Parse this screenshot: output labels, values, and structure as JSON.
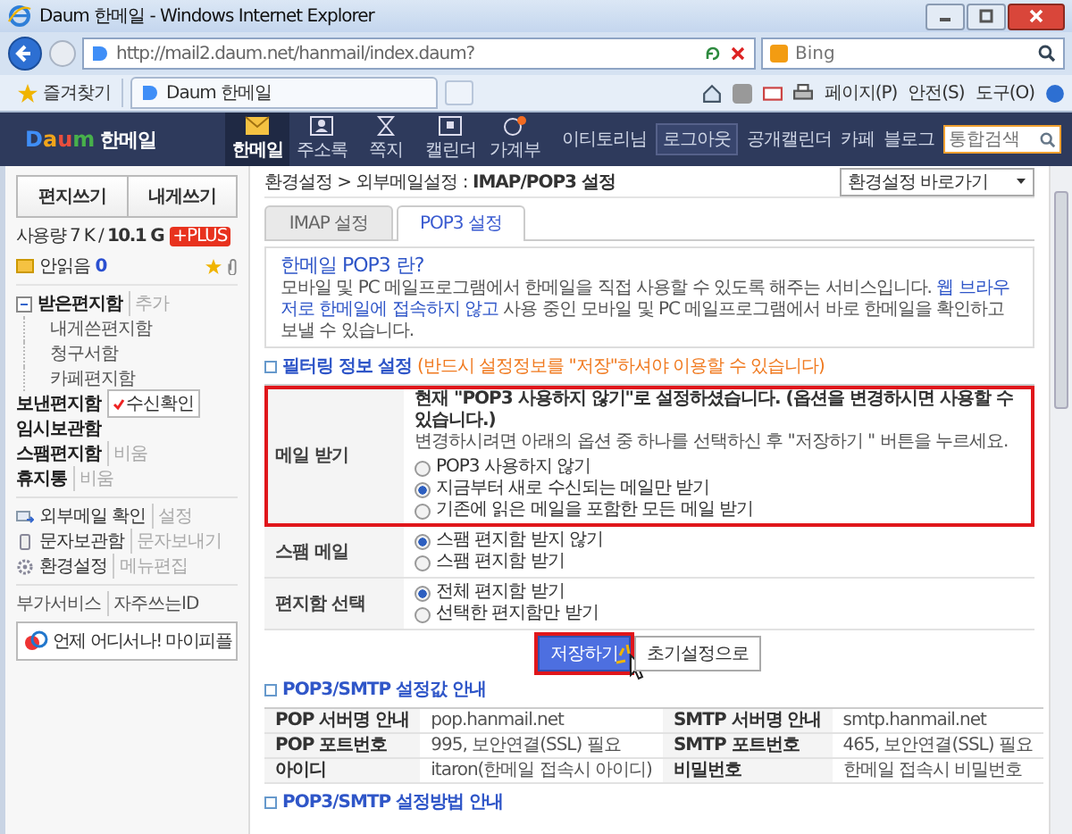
{
  "window": {
    "title": "Daum 한메일 - Windows Internet Explorer"
  },
  "address_bar": {
    "url": "http://mail2.daum.net/hanmail/index.daum?"
  },
  "search_box": {
    "placeholder": "Bing"
  },
  "favorites_bar": {
    "favorites": "즐겨찾기",
    "tab": "Daum 한메일",
    "commands": [
      "페이지(P)",
      "안전(S)",
      "도구(O)"
    ]
  },
  "site_header": {
    "logo": "Daum",
    "service": "한메일",
    "nav": [
      {
        "label": "한메일",
        "kind": "mail",
        "selected": true
      },
      {
        "label": "주소록",
        "kind": "contacts",
        "selected": false
      },
      {
        "label": "쪽지",
        "kind": "note",
        "selected": false
      },
      {
        "label": "캘린더",
        "kind": "calendar",
        "selected": false
      },
      {
        "label": "가계부",
        "kind": "budget",
        "selected": false
      }
    ],
    "user": "이티토리님",
    "logout": "로그아웃",
    "links": [
      "공개캘린더",
      "카페",
      "블로그"
    ],
    "search": {
      "placeholder": "통합검색"
    }
  },
  "sidebar": {
    "buttons": [
      "편지쓰기",
      "내게쓰기"
    ],
    "usage": {
      "text": "사용량 7 K / **10.1 G**",
      "badge": "+PLUS"
    },
    "unread": {
      "label": "안읽음",
      "count": "0"
    },
    "folders": [
      {
        "name": "받은편지함",
        "expanded": true,
        "action": "추가",
        "children": [
          {
            "name": "내게쓴편지함"
          },
          {
            "name": "청구서함"
          },
          {
            "name": "카페편지함"
          }
        ]
      },
      {
        "name": "보낸편지함",
        "tag": "수신확인"
      },
      {
        "name": "임시보관함"
      },
      {
        "name": "스팸편지함",
        "action": "비움"
      },
      {
        "name": "휴지통",
        "action": "비움"
      }
    ],
    "tools": [
      {
        "name": "외부메일 확인",
        "kind": "external",
        "action": "설정"
      },
      {
        "name": "문자보관함",
        "kind": "sms",
        "action": "문자보내기"
      },
      {
        "name": "환경설정",
        "kind": "settings",
        "action": "메뉴편집"
      }
    ],
    "extras": [
      "부가서비스",
      "자주쓰는ID"
    ],
    "promo_button": "언제 어디서나! 마이피플"
  },
  "main": {
    "breadcrumb": "환경설정 > 외부메일설정 : **IMAP/POP3 설정**",
    "shortcut_select": {
      "value": "환경설정 바로가기"
    },
    "tabs": [
      {
        "label": "IMAP 설정",
        "selected": false
      },
      {
        "label": "POP3 설정",
        "selected": true
      }
    ],
    "info": {
      "title": "한메일 POP3 란?",
      "text": "모바일 및 PC 메일프로그램에서 한메일을 직접 사용할 수 있도록 해주는 서비스입니다. **웹 브라우저로 한메일에 접속하지 않고** 사용 중인 모바일 및 PC 메일프로그램에서 바로 한메일을 확인하고 보낼 수 있습니다."
    },
    "filter_section": {
      "title": "필터링 정보 설정",
      "note": "(반드시 설정정보를 \"저장\"하셔야 이용할 수 있습니다)"
    },
    "settings": [
      {
        "label": "메일 받기",
        "highlighted": true,
        "notice": "현재 \"POP3 사용하지 않기\"로 설정하셨습니다. (옵션을 변경하시면 사용할 수 있습니다.)",
        "hint": "변경하시려면 아래의 옵션 중 하나를 선택하신 후 \"저장하기 \" 버튼을 누르세요.",
        "options": [
          {
            "label": "POP3 사용하지 않기",
            "selected": false
          },
          {
            "label": "지금부터 새로 수신되는 메일만 받기",
            "selected": true
          },
          {
            "label": "기존에 읽은 메일을 포함한 모든 메일 받기",
            "selected": false
          }
        ]
      },
      {
        "label": "스팸 메일",
        "highlighted": false,
        "options": [
          {
            "label": "스팸 편지함 받지 않기",
            "selected": true
          },
          {
            "label": "스팸 편지함 받기",
            "selected": false
          }
        ]
      },
      {
        "label": "편지함 선택",
        "highlighted": false,
        "options": [
          {
            "label": "전체 편지함 받기",
            "selected": true
          },
          {
            "label": "선택한 편지함만 받기",
            "selected": false
          }
        ]
      }
    ],
    "actions": [
      {
        "label": "저장하기",
        "kind": "primary",
        "highlighted": true
      },
      {
        "label": "초기설정으로",
        "kind": "secondary",
        "highlighted": false
      }
    ],
    "server_section": {
      "title": "POP3/SMTP 설정값 안내",
      "rows": [
        [
          "POP 서버명 안내",
          "pop.hanmail.net",
          "SMTP 서버명 안내",
          "smtp.hanmail.net"
        ],
        [
          "POP 포트번호",
          "995, 보안연결(SSL) 필요",
          "SMTP 포트번호",
          "465, 보안연결(SSL) 필요"
        ],
        [
          "아이디",
          "itaron(한메일 접속시 아이디)",
          "비밀번호",
          "한메일 접속시 비밀번호"
        ]
      ]
    },
    "method_section": {
      "title": "POP3/SMTP 설정방법 안내"
    }
  }
}
